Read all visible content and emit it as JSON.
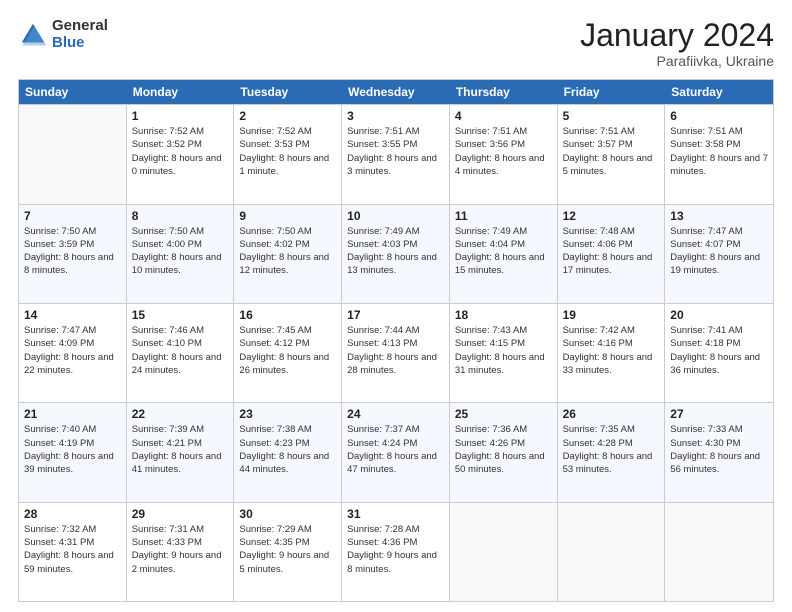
{
  "logo": {
    "general": "General",
    "blue": "Blue"
  },
  "title": "January 2024",
  "location": "Parafiivka, Ukraine",
  "weekdays": [
    "Sunday",
    "Monday",
    "Tuesday",
    "Wednesday",
    "Thursday",
    "Friday",
    "Saturday"
  ],
  "rows": [
    [
      {
        "day": "",
        "sunrise": "",
        "sunset": "",
        "daylight": "",
        "empty": true
      },
      {
        "day": "1",
        "sunrise": "Sunrise: 7:52 AM",
        "sunset": "Sunset: 3:52 PM",
        "daylight": "Daylight: 8 hours and 0 minutes."
      },
      {
        "day": "2",
        "sunrise": "Sunrise: 7:52 AM",
        "sunset": "Sunset: 3:53 PM",
        "daylight": "Daylight: 8 hours and 1 minute."
      },
      {
        "day": "3",
        "sunrise": "Sunrise: 7:51 AM",
        "sunset": "Sunset: 3:55 PM",
        "daylight": "Daylight: 8 hours and 3 minutes."
      },
      {
        "day": "4",
        "sunrise": "Sunrise: 7:51 AM",
        "sunset": "Sunset: 3:56 PM",
        "daylight": "Daylight: 8 hours and 4 minutes."
      },
      {
        "day": "5",
        "sunrise": "Sunrise: 7:51 AM",
        "sunset": "Sunset: 3:57 PM",
        "daylight": "Daylight: 8 hours and 5 minutes."
      },
      {
        "day": "6",
        "sunrise": "Sunrise: 7:51 AM",
        "sunset": "Sunset: 3:58 PM",
        "daylight": "Daylight: 8 hours and 7 minutes."
      }
    ],
    [
      {
        "day": "7",
        "sunrise": "Sunrise: 7:50 AM",
        "sunset": "Sunset: 3:59 PM",
        "daylight": "Daylight: 8 hours and 8 minutes."
      },
      {
        "day": "8",
        "sunrise": "Sunrise: 7:50 AM",
        "sunset": "Sunset: 4:00 PM",
        "daylight": "Daylight: 8 hours and 10 minutes."
      },
      {
        "day": "9",
        "sunrise": "Sunrise: 7:50 AM",
        "sunset": "Sunset: 4:02 PM",
        "daylight": "Daylight: 8 hours and 12 minutes."
      },
      {
        "day": "10",
        "sunrise": "Sunrise: 7:49 AM",
        "sunset": "Sunset: 4:03 PM",
        "daylight": "Daylight: 8 hours and 13 minutes."
      },
      {
        "day": "11",
        "sunrise": "Sunrise: 7:49 AM",
        "sunset": "Sunset: 4:04 PM",
        "daylight": "Daylight: 8 hours and 15 minutes."
      },
      {
        "day": "12",
        "sunrise": "Sunrise: 7:48 AM",
        "sunset": "Sunset: 4:06 PM",
        "daylight": "Daylight: 8 hours and 17 minutes."
      },
      {
        "day": "13",
        "sunrise": "Sunrise: 7:47 AM",
        "sunset": "Sunset: 4:07 PM",
        "daylight": "Daylight: 8 hours and 19 minutes."
      }
    ],
    [
      {
        "day": "14",
        "sunrise": "Sunrise: 7:47 AM",
        "sunset": "Sunset: 4:09 PM",
        "daylight": "Daylight: 8 hours and 22 minutes."
      },
      {
        "day": "15",
        "sunrise": "Sunrise: 7:46 AM",
        "sunset": "Sunset: 4:10 PM",
        "daylight": "Daylight: 8 hours and 24 minutes."
      },
      {
        "day": "16",
        "sunrise": "Sunrise: 7:45 AM",
        "sunset": "Sunset: 4:12 PM",
        "daylight": "Daylight: 8 hours and 26 minutes."
      },
      {
        "day": "17",
        "sunrise": "Sunrise: 7:44 AM",
        "sunset": "Sunset: 4:13 PM",
        "daylight": "Daylight: 8 hours and 28 minutes."
      },
      {
        "day": "18",
        "sunrise": "Sunrise: 7:43 AM",
        "sunset": "Sunset: 4:15 PM",
        "daylight": "Daylight: 8 hours and 31 minutes."
      },
      {
        "day": "19",
        "sunrise": "Sunrise: 7:42 AM",
        "sunset": "Sunset: 4:16 PM",
        "daylight": "Daylight: 8 hours and 33 minutes."
      },
      {
        "day": "20",
        "sunrise": "Sunrise: 7:41 AM",
        "sunset": "Sunset: 4:18 PM",
        "daylight": "Daylight: 8 hours and 36 minutes."
      }
    ],
    [
      {
        "day": "21",
        "sunrise": "Sunrise: 7:40 AM",
        "sunset": "Sunset: 4:19 PM",
        "daylight": "Daylight: 8 hours and 39 minutes."
      },
      {
        "day": "22",
        "sunrise": "Sunrise: 7:39 AM",
        "sunset": "Sunset: 4:21 PM",
        "daylight": "Daylight: 8 hours and 41 minutes."
      },
      {
        "day": "23",
        "sunrise": "Sunrise: 7:38 AM",
        "sunset": "Sunset: 4:23 PM",
        "daylight": "Daylight: 8 hours and 44 minutes."
      },
      {
        "day": "24",
        "sunrise": "Sunrise: 7:37 AM",
        "sunset": "Sunset: 4:24 PM",
        "daylight": "Daylight: 8 hours and 47 minutes."
      },
      {
        "day": "25",
        "sunrise": "Sunrise: 7:36 AM",
        "sunset": "Sunset: 4:26 PM",
        "daylight": "Daylight: 8 hours and 50 minutes."
      },
      {
        "day": "26",
        "sunrise": "Sunrise: 7:35 AM",
        "sunset": "Sunset: 4:28 PM",
        "daylight": "Daylight: 8 hours and 53 minutes."
      },
      {
        "day": "27",
        "sunrise": "Sunrise: 7:33 AM",
        "sunset": "Sunset: 4:30 PM",
        "daylight": "Daylight: 8 hours and 56 minutes."
      }
    ],
    [
      {
        "day": "28",
        "sunrise": "Sunrise: 7:32 AM",
        "sunset": "Sunset: 4:31 PM",
        "daylight": "Daylight: 8 hours and 59 minutes."
      },
      {
        "day": "29",
        "sunrise": "Sunrise: 7:31 AM",
        "sunset": "Sunset: 4:33 PM",
        "daylight": "Daylight: 9 hours and 2 minutes."
      },
      {
        "day": "30",
        "sunrise": "Sunrise: 7:29 AM",
        "sunset": "Sunset: 4:35 PM",
        "daylight": "Daylight: 9 hours and 5 minutes."
      },
      {
        "day": "31",
        "sunrise": "Sunrise: 7:28 AM",
        "sunset": "Sunset: 4:36 PM",
        "daylight": "Daylight: 9 hours and 8 minutes."
      },
      {
        "day": "",
        "sunrise": "",
        "sunset": "",
        "daylight": "",
        "empty": true
      },
      {
        "day": "",
        "sunrise": "",
        "sunset": "",
        "daylight": "",
        "empty": true
      },
      {
        "day": "",
        "sunrise": "",
        "sunset": "",
        "daylight": "",
        "empty": true
      }
    ]
  ]
}
